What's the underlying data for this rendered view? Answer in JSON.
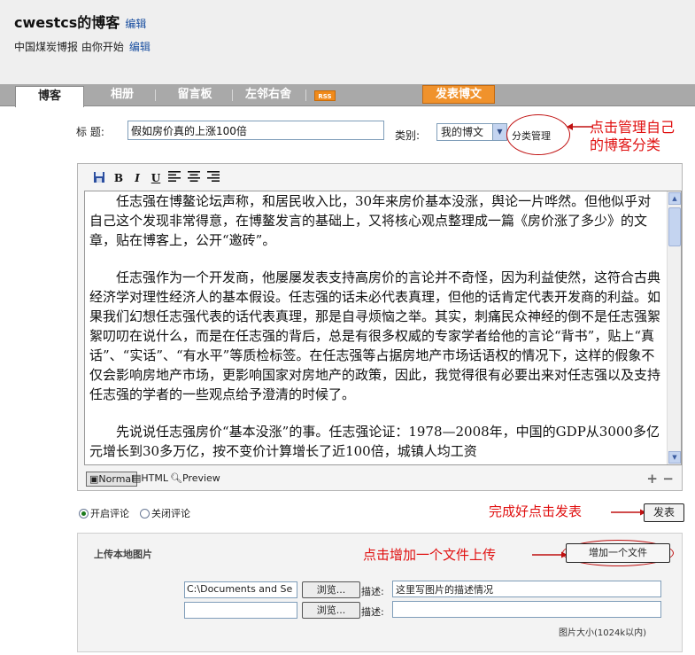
{
  "header": {
    "blog_title": "cwestcs的博客",
    "title_edit": "编辑",
    "subtitle": "中国煤炭博报  由你开始",
    "subtitle_edit": "编辑"
  },
  "nav": {
    "tabs": [
      {
        "label": "博客"
      },
      {
        "label": "相册"
      },
      {
        "label": "留言板"
      },
      {
        "label": "左邻右舍"
      }
    ],
    "rss": "RSS",
    "publish": "发表博文"
  },
  "form": {
    "title_label": "标  题:",
    "title_value": "假如房价真的上涨100倍",
    "category_label": "类别:",
    "category_value": "我的博文",
    "category_manage": "分类管理"
  },
  "annotations": {
    "manage_line1": "点击管理自己",
    "manage_line2": "的博客分类",
    "publish_note": "完成好点击发表",
    "upload_note": "点击增加一个文件上传"
  },
  "editor": {
    "toolbar": {
      "bold": "B",
      "italic": "I",
      "underline": "U"
    },
    "paragraphs": [
      "任志强在博鳌论坛声称，和居民收入比，30年来房价基本没涨，舆论一片哗然。但他似乎对自己这个发现非常得意，在博鳌发言的基础上，又将核心观点整理成一篇《房价涨了多少》的文章，贴在博客上，公开“邀砖”。",
      "任志强作为一个开发商，他屡屡发表支持高房价的言论并不奇怪，因为利益使然，这符合古典经济学对理性经济人的基本假设。任志强的话未必代表真理，但他的话肯定代表开发商的利益。如果我们幻想任志强代表的话代表真理，那是自寻烦恼之举。其实，刺痛民众神经的倒不是任志强絮絮叨叨在说什么，而是在任志强的背后，总是有很多权威的专家学者给他的言论“背书”，贴上“真话”、“实话”、“有水平”等质检标签。在任志强等占据房地产市场话语权的情况下，这样的假象不仅会影响房地产市场，更影响国家对房地产的政策，因此，我觉得很有必要出来对任志强以及支持任志强的学者的一些观点给予澄清的时候了。",
      "先说说任志强房价“基本没涨”的事。任志强论证：1978—2008年，中国的GDP从3000多亿元增长到30多万亿，按不变价计算增长了近100倍，城镇人均工资"
    ],
    "modes": {
      "normal": "Normal",
      "html": "HTML",
      "preview": "Preview"
    },
    "zoom_in": "+",
    "zoom_out": "−"
  },
  "comments": {
    "on": "开启评论",
    "off": "关闭评论"
  },
  "submit": "发表",
  "upload": {
    "title": "上传本地图片",
    "add_button": "增加一个文件",
    "rows": [
      {
        "file": "C:\\Documents and Se",
        "browse": "浏览...",
        "desc_label": "描述:",
        "desc": "这里写图片的描述情况"
      },
      {
        "file": "",
        "browse": "浏览...",
        "desc_label": "描述:",
        "desc": ""
      }
    ],
    "size_note": "图片大小(1024k以内)"
  },
  "colors": {
    "nav_bg": "#a9a9a9",
    "publish_orange": "#f0922c",
    "annotation_red": "#e01010",
    "link_blue": "#1a4fa0"
  }
}
